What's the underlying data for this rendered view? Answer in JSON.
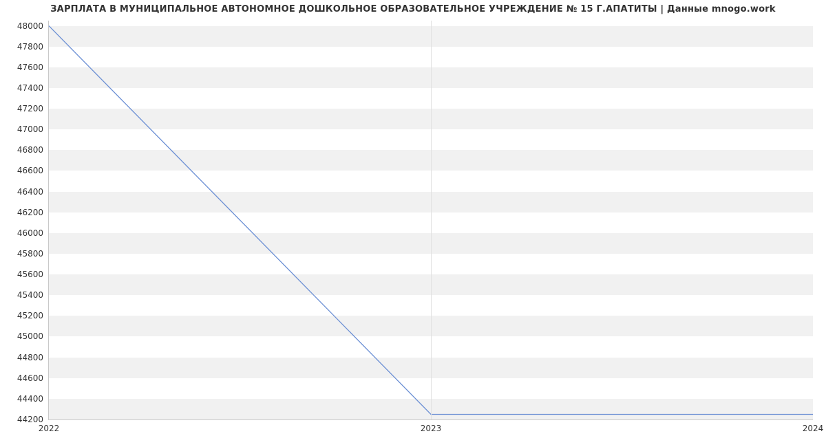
{
  "chart_data": {
    "type": "line",
    "title": "ЗАРПЛАТА В МУНИЦИПАЛЬНОЕ АВТОНОМНОЕ ДОШКОЛЬНОЕ ОБРАЗОВАТЕЛЬНОЕ УЧРЕЖДЕНИЕ № 15 Г.АПАТИТЫ | Данные mnogo.work",
    "x": [
      2022,
      2023,
      2024
    ],
    "series": [
      {
        "name": "salary",
        "values": [
          48000,
          44250,
          44250
        ],
        "color": "#6b8fd4"
      }
    ],
    "xticks": [
      {
        "value": 2022,
        "label": "2022"
      },
      {
        "value": 2023,
        "label": "2023"
      },
      {
        "value": 2024,
        "label": "2024"
      }
    ],
    "yticks": [
      44200,
      44400,
      44600,
      44800,
      45000,
      45200,
      45400,
      45600,
      45800,
      46000,
      46200,
      46400,
      46600,
      46800,
      47000,
      47200,
      47400,
      47600,
      47800,
      48000
    ],
    "xlim": [
      2022,
      2024
    ],
    "ylim": [
      44200,
      48050
    ],
    "xlabel": "",
    "ylabel": ""
  }
}
